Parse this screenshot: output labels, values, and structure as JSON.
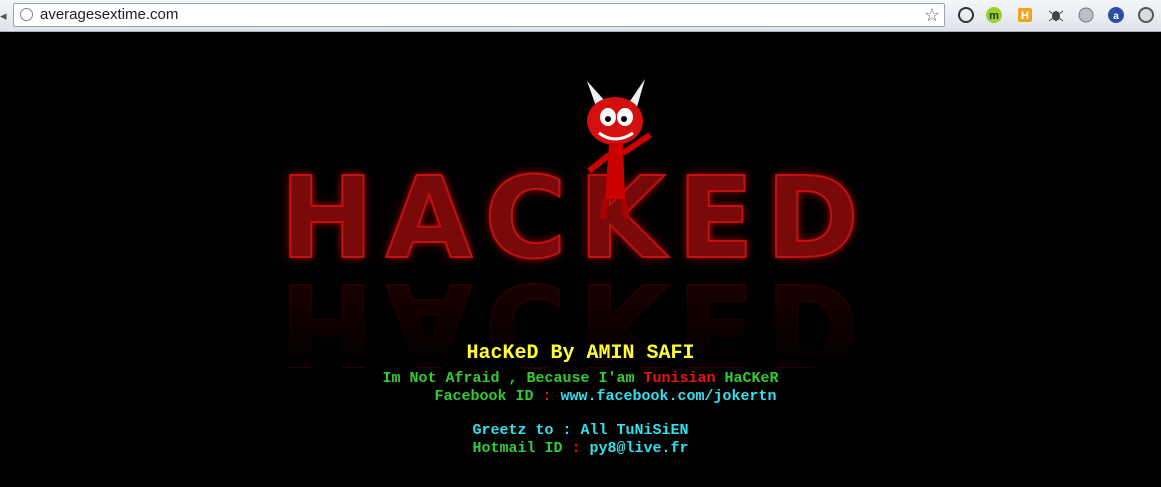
{
  "browser": {
    "url": "averagesextime.com",
    "extensions": [
      "chrome-icon",
      "m-icon",
      "h-icon",
      "bug-icon",
      "globe-icon",
      "a-icon",
      "shield-icon"
    ]
  },
  "page": {
    "logo_text": "HACKED",
    "title": "HacKeD By AMIN SAFI",
    "line1_a": "Im Not Afraid , Because I'am ",
    "line1_b": "Tunisian",
    "line1_c": " HaCKeR",
    "fb_label": "Facebook ID",
    "sep": " : ",
    "fb_value": "www.facebook.com/jokertn",
    "greetz": "Greetz to : All TuNiSiEN",
    "hotmail_label": "Hotmail ID",
    "hotmail_value": "py8@live.fr"
  },
  "colors": {
    "title": "#ffff33",
    "green": "#33cc33",
    "red": "#ee1111",
    "cyan": "#33e0ee"
  }
}
